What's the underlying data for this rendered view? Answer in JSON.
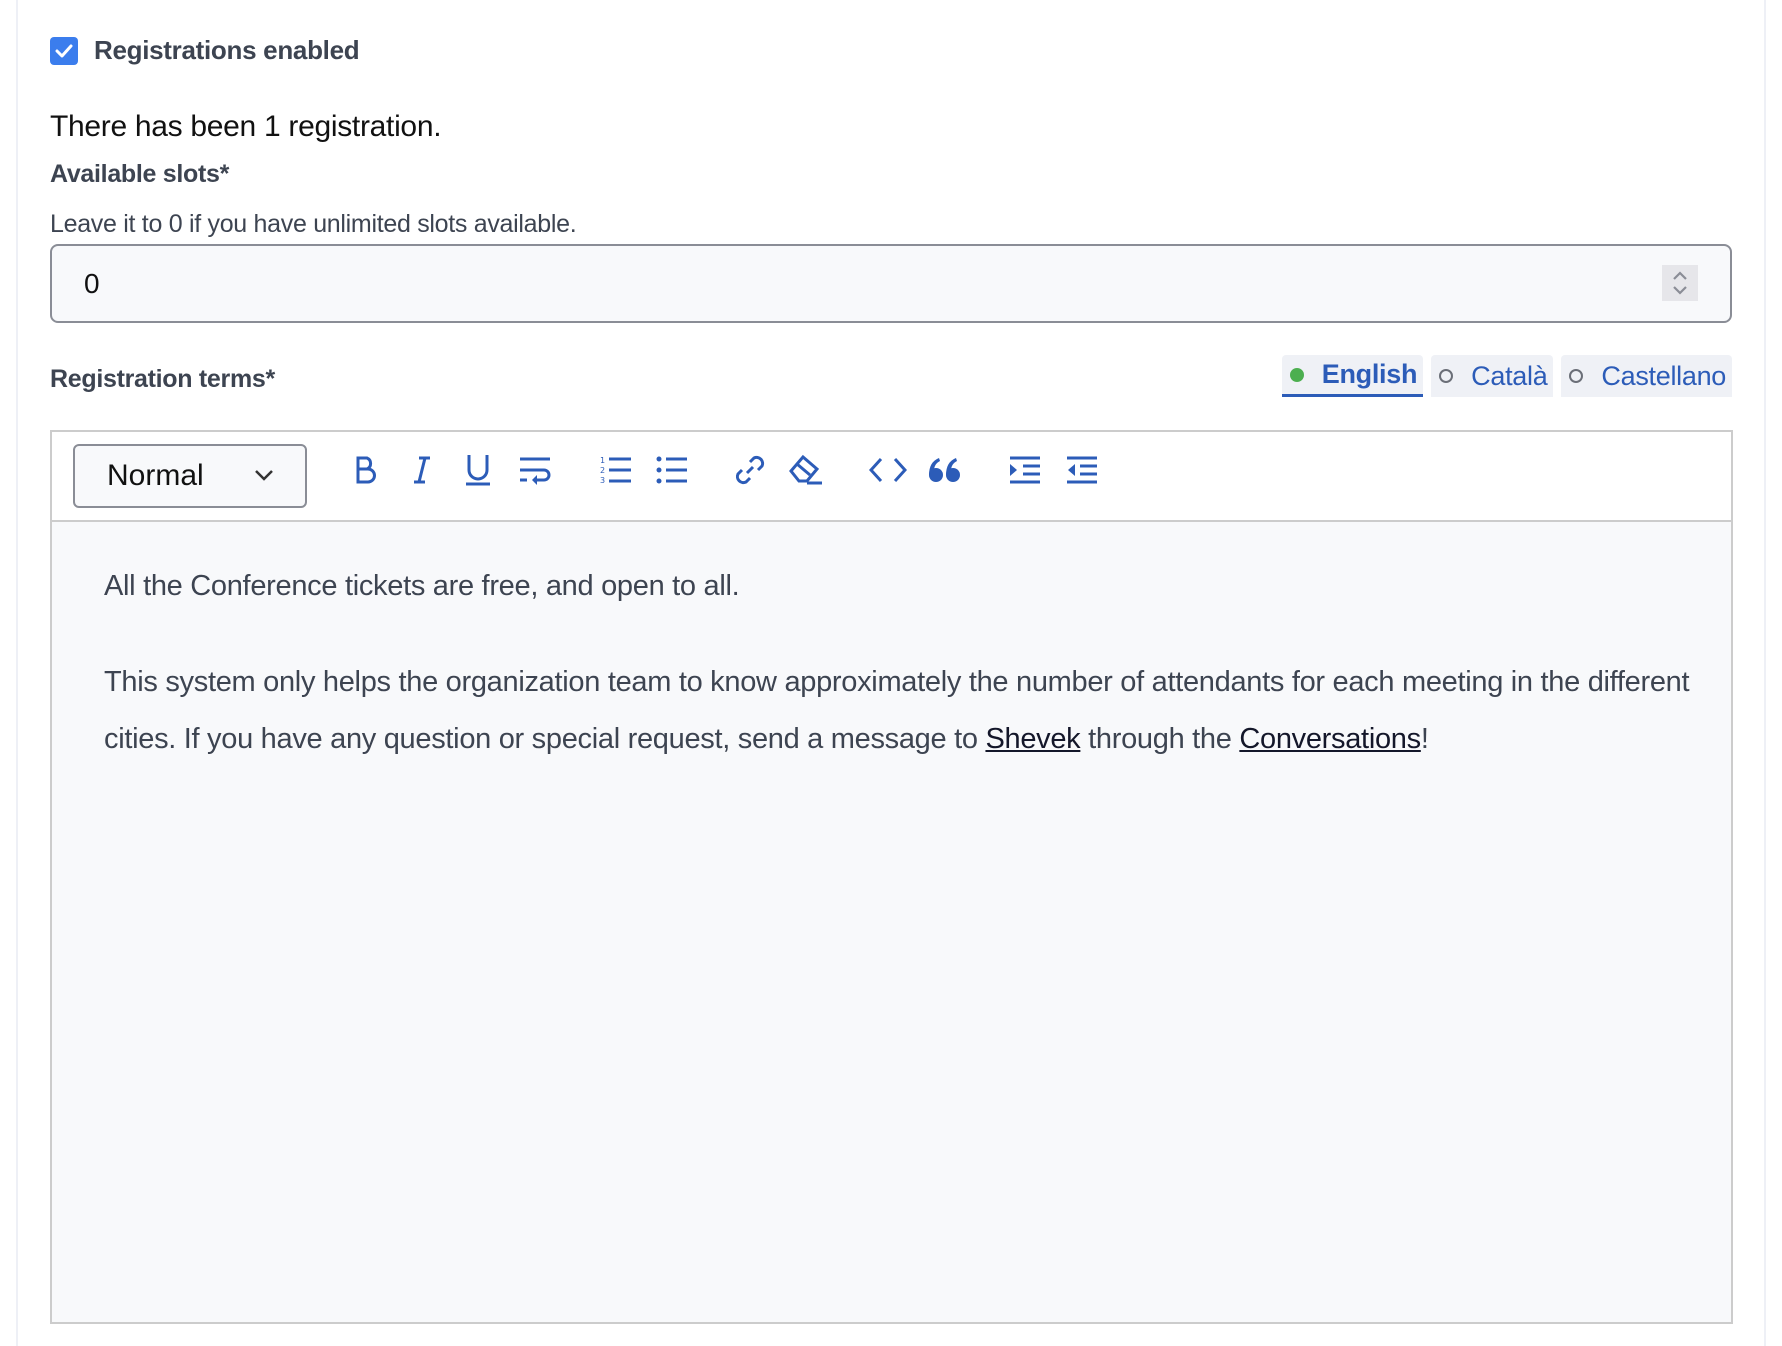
{
  "registration": {
    "enabled_label": "Registrations enabled",
    "enabled": true,
    "count_text": "There has been 1 registration."
  },
  "slots": {
    "label": "Available slots*",
    "help": "Leave it to 0 if you have unlimited slots available.",
    "value": "0"
  },
  "terms": {
    "label": "Registration terms*",
    "languages": [
      {
        "label": "English",
        "active": true,
        "status": "filled"
      },
      {
        "label": "Català",
        "active": false,
        "status": "empty"
      },
      {
        "label": "Castellano",
        "active": false,
        "status": "empty"
      }
    ],
    "toolbar": {
      "format_value": "Normal",
      "buttons": [
        "bold",
        "italic",
        "underline",
        "hard-break",
        "ordered-list",
        "bullet-list",
        "link",
        "clear-formatting",
        "code-block",
        "blockquote",
        "indent",
        "outdent"
      ]
    },
    "content": {
      "p1": "All the Conference tickets are free, and open to all.",
      "p2_before": "This system only helps the organization team to know approximately the number of attendants for each meeting in the different cities. If you have any question or special request, send a message to ",
      "link1": "Shevek",
      "p2_middle": " through the ",
      "link2": "Conversations",
      "p2_after": "!"
    }
  },
  "colors": {
    "accent": "#3b7ded",
    "link_blue": "#2c5cb8",
    "status_green": "#4caf50",
    "text": "#3d4451"
  }
}
